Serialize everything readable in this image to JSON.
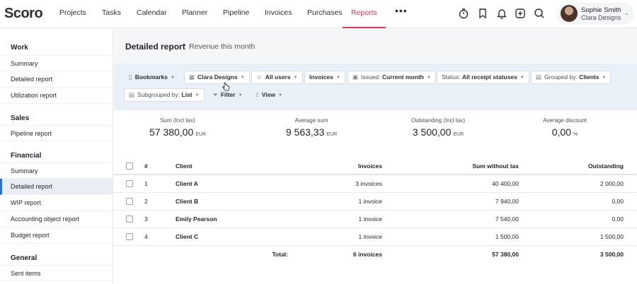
{
  "topbar": {
    "logo": "Scoro",
    "nav": [
      "Projects",
      "Tasks",
      "Calendar",
      "Planner",
      "Pipeline",
      "Invoices",
      "Purchases",
      "Reports"
    ],
    "active_nav": "Reports",
    "more": "•••",
    "icons": [
      "timer-icon",
      "bookmark-icon",
      "bell-icon",
      "add-icon",
      "search-icon"
    ],
    "user": {
      "name": "Sophie Smith",
      "company": "Clara Designs"
    }
  },
  "sidebar": {
    "sections": [
      {
        "title": "Work",
        "items": [
          "Summary",
          "Detailed report",
          "Utilization report"
        ]
      },
      {
        "title": "Sales",
        "items": [
          "Pipeline report"
        ]
      },
      {
        "title": "Financial",
        "items": [
          "Summary",
          "Detailed report",
          "WIP report",
          "Accounting object report",
          "Budget report"
        ]
      },
      {
        "title": "General",
        "items": [
          "Sent items"
        ]
      }
    ],
    "active": "Financial/Detailed report"
  },
  "header": {
    "title": "Detailed report",
    "separator": "›",
    "crumb": "Revenue this month"
  },
  "filters": {
    "bookmarks": "Bookmarks",
    "company": "Clara Designs",
    "users": "All users",
    "type": "Invoices",
    "issued_label": "Issued:",
    "issued_value": "Current month",
    "status_label": "Status:",
    "status_value": "All receipt statuses",
    "grouped_label": "Grouped by:",
    "grouped_value": "Clients",
    "subgrouped_label": "Subgrouped by:",
    "subgrouped_value": "List",
    "filter": "Filter",
    "view": "View"
  },
  "summary": [
    {
      "label": "Sum (Incl tax)",
      "value": "57 380,00",
      "unit": "EUR"
    },
    {
      "label": "Average sum",
      "value": "9 563,33",
      "unit": "EUR"
    },
    {
      "label": "Outstanding (Incl tax)",
      "value": "3 500,00",
      "unit": "EUR"
    },
    {
      "label": "Average discount",
      "value": "0,00",
      "unit": "%"
    }
  ],
  "table": {
    "headers": {
      "num": "#",
      "client": "Client",
      "invoices": "Invoices",
      "sum": "Sum without tax",
      "outstanding": "Outstanding"
    },
    "rows": [
      {
        "num": "1",
        "client": "Client A",
        "invoices": "3 invoices",
        "sum": "40 400,00",
        "outstanding": "2 000,00"
      },
      {
        "num": "2",
        "client": "Client B",
        "invoices": "1 invoice",
        "sum": "7 940,00",
        "outstanding": "0,00"
      },
      {
        "num": "3",
        "client": "Emily Pearson",
        "invoices": "1 invoice",
        "sum": "7 540,00",
        "outstanding": "0,00"
      },
      {
        "num": "4",
        "client": "Client C",
        "invoices": "1 invoice",
        "sum": "1 500,00",
        "outstanding": "1 500,00"
      }
    ],
    "total": {
      "label": "Total:",
      "invoices": "6 invoices",
      "sum": "57 380,00",
      "outstanding": "3 500,00"
    }
  },
  "colors": {
    "accent": "#d23c57",
    "active_border": "#2d73c8",
    "filter_bg": "#e9f0f8"
  }
}
